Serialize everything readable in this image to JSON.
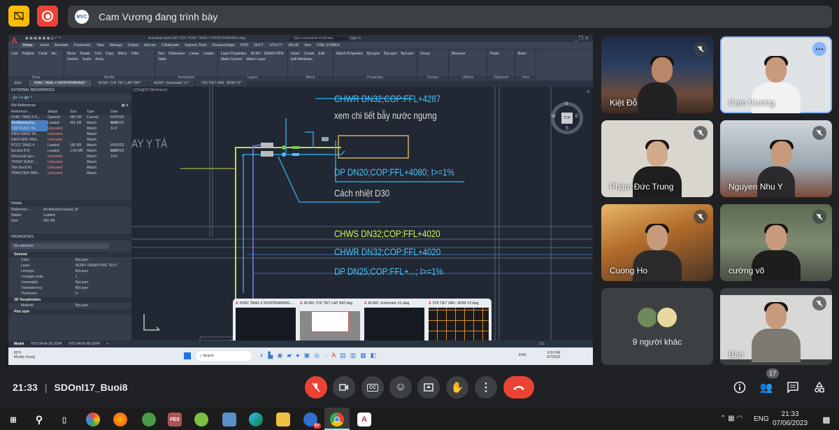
{
  "top": {
    "presenter_initials": "MVC",
    "presenter_text": "Cam Vương đang trình bày"
  },
  "autocad": {
    "title": "Autodesk AutoCAD 2021  HVAC TANG 4 SHOPDRAWING.dwg",
    "search_placeholder": "Type a keyword or phrase",
    "sign_in": "Sign In",
    "menu": [
      "Home",
      "Insert",
      "Annotate",
      "Parametric",
      "View",
      "Manage",
      "Output",
      "Add-ins",
      "Collaborate",
      "Express Tools",
      "Featured Apps",
      "PIPE",
      "DUCT",
      "UTILITY",
      "VALVE",
      "Item",
      "FIRE SYMBOL"
    ],
    "ribbon": {
      "draw": {
        "label": "Draw",
        "items": [
          "Line",
          "Polyline",
          "Circle",
          "Arc"
        ]
      },
      "modify": {
        "label": "Modify",
        "items": [
          "Move",
          "Rotate",
          "Trim",
          "Copy",
          "Mirror",
          "Fillet",
          "Stretch",
          "Scale",
          "Array"
        ]
      },
      "annotation": {
        "label": "Annotation",
        "items": [
          "Text",
          "Dimension",
          "Linear",
          "Leader",
          "Table"
        ]
      },
      "layers": {
        "label": "Layers",
        "items": [
          "Layer Properties",
          "ACMV - DRAIN PIPE",
          "Make Current",
          "Match Layer"
        ]
      },
      "block": {
        "label": "Block",
        "items": [
          "Insert",
          "Create",
          "Edit",
          "Edit Attributes"
        ]
      },
      "properties": {
        "label": "Properties",
        "items": [
          "Match Properties",
          "ByLayer",
          "ByLayer",
          "ByLayer"
        ]
      },
      "groups": {
        "label": "Groups",
        "items": [
          "Group"
        ]
      },
      "utilities": {
        "label": "Utilities",
        "items": [
          "Measure"
        ]
      },
      "clipboard": {
        "label": "Clipboard",
        "items": [
          "Paste"
        ]
      },
      "view": {
        "label": "View",
        "items": [
          "Base"
        ]
      }
    },
    "file_tabs": [
      "Start",
      "HVAC TANG 4 SHOPDRAWING*",
      "ACMV- CHI TIET LAP DAT*",
      "ACMV- Schematic V1*",
      "CHI TIET VAN - BOM V2*"
    ],
    "viewport_label": "[-][Top][2D Wireframe]",
    "xref": {
      "title": "EXTERNAL REFERENCES",
      "section": "File References",
      "columns": [
        "Reference ...",
        "Status",
        "Size",
        "Type",
        "Date"
      ],
      "rows": [
        [
          "HVAC TANG 4 S...",
          "Opened",
          "480 KB",
          "Current",
          "6/4/2023 11:4"
        ],
        [
          "Architectural la...",
          "Loaded",
          "491 KB",
          "Attach",
          "6/4/2023 11:0"
        ],
        [
          "CAP NUOC TA...",
          "Unloaded",
          "",
          "Attach",
          ""
        ],
        [
          "DIEN NANG TA...",
          "Unloaded",
          "",
          "Attach",
          ""
        ],
        [
          "DIEN NHE TANI...",
          "Unloaded",
          "",
          "Attach",
          ""
        ],
        [
          "PCCC TANG 4",
          "Loaded",
          "190 KB",
          "Attach",
          "6/4/2022 9:27"
        ],
        [
          "Section B-B",
          "Loaded",
          "1.59 MB",
          "Attach",
          "6/4/2022 10:5"
        ],
        [
          "Structural layo...",
          "Unloaded",
          "",
          "Attach",
          ""
        ],
        [
          "THOAT NUOC ...",
          "Unloaded",
          "",
          "Attach",
          ""
        ],
        [
          "Title block A1",
          "Unloaded",
          "",
          "Attach",
          ""
        ],
        [
          "TRAN DEN TANI...",
          "Unloaded",
          "",
          "Attach",
          ""
        ]
      ],
      "details_title": "Details",
      "details": [
        [
          "Reference ...",
          "Architectural layout_4f"
        ],
        [
          "Status",
          "Loaded"
        ],
        [
          "Size",
          "491 KB"
        ]
      ]
    },
    "properties": {
      "title": "PROPERTIES",
      "selection": "No selection",
      "general_label": "General",
      "general": [
        [
          "Color",
          "ByLayer"
        ],
        [
          "Layer",
          "ACMV- DRAIN PIPE TEXT"
        ],
        [
          "Linetype",
          "ByLayer"
        ],
        [
          "Linetype scale",
          "1"
        ],
        [
          "Lineweight",
          "ByLayer"
        ],
        [
          "Transparency",
          "ByLayer"
        ],
        [
          "Thickness",
          "0"
        ]
      ],
      "viz_label": "3D Visualization",
      "viz": [
        [
          "Material",
          "ByLayer"
        ]
      ],
      "plot_label": "Plot style"
    },
    "drawing_text": {
      "room": "AY Y TÁ",
      "t1": "CHWR DN32;COP:FFL+4287",
      "t2": "xem chi tiết bẫy nước ngưng",
      "t3": "DP DN20;COP:FFL+4080; I>=1%",
      "t4": "Cách nhiệt D30",
      "t5": "CHWS DN32;COP:FFL+4020",
      "t6": "CHWR DN32;COP:FFL+4020",
      "t7": "DP DN25;COP:FFL+...; I>=1%"
    },
    "viewcube": {
      "top": "TOP",
      "n": "N",
      "s": "S",
      "e": "E",
      "w": "W"
    },
    "layout_tabs": [
      "Model",
      "HTS-94-M-3D-2004",
      "HTS-94-M-3D-3004",
      "+"
    ],
    "status_scale": "1:1",
    "thumbnails": [
      "HVAC TANG 4 SHOPDRAWING....",
      "ACMV- CHI TIET LAP DAT.dwg",
      "ACMV- Schematic V1.dwg",
      "CHI TIET VAN - BOM V2.dwg"
    ],
    "win_weather": {
      "temp": "83°F",
      "text": "Mostly cloudy"
    },
    "win_search": "Search",
    "win_lang": "ENG",
    "win_time": "9:33 PM",
    "win_date": "6/7/2023"
  },
  "participants": [
    {
      "name": "Kiệt Đỗ",
      "muted": true
    },
    {
      "name": "Cam Vương",
      "muted": false
    },
    {
      "name": "Phạm Đức Trung",
      "muted": true
    },
    {
      "name": "Nguyen Nhu Y",
      "muted": true
    },
    {
      "name": "Cuong Ho",
      "muted": true
    },
    {
      "name": "cường võ",
      "muted": true
    },
    {
      "name": "Bạn",
      "muted": true
    }
  ],
  "others_label": "9 người khác",
  "meeting": {
    "time": "21:33",
    "name": "SDOnl17_Buoi8",
    "participant_count": "17"
  },
  "colors": {
    "end_call": "#ea4335",
    "accent_blue": "#8ab4f8",
    "cad_cyan": "#4fc3f7",
    "cad_green": "#d4f55c"
  },
  "taskbar": {
    "lang": "ENG",
    "time": "21:33",
    "date": "07/06/2023",
    "badge": "5+"
  }
}
